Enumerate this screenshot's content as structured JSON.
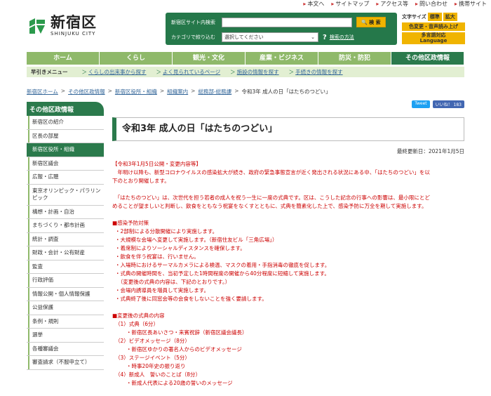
{
  "util_links": [
    "本文へ",
    "サイトマップ",
    "アクセス等",
    "問い合わせ",
    "携帯サイト"
  ],
  "logo": {
    "name": "新宿区",
    "roman": "SHINJUKU CITY"
  },
  "search": {
    "site_label": "新宿区サイト内検索",
    "button": "検 索",
    "category_label": "カテゴリで絞り込む",
    "category_value": "選択してください",
    "help_q": "?",
    "help_link": "検索の方法"
  },
  "tools": {
    "font_size_label": "文字サイズ",
    "standard": "標準",
    "enlarge": "拡大",
    "color_voice": "色変更・音声読み上げ",
    "multilang_1": "多言語対応",
    "multilang_2": "Language"
  },
  "gnav": [
    "ホーム",
    "くらし",
    "観光・文化",
    "産業・ビジネス",
    "防災・防犯",
    "その他区政情報"
  ],
  "subnav": {
    "title": "早引きメニュー",
    "links": [
      "くらしの出来事から探す",
      "よく見られているページ",
      "施設の情報を探す",
      "手続きの情報を探す"
    ]
  },
  "breadcrumb": [
    "新宿区ホーム",
    "その他区政情報",
    "新宿区役所・組織",
    "組織案内",
    "総務部-総務課",
    "令和3年 成人の日「はたちのつどい」"
  ],
  "sidebar": {
    "heading": "その他区政情報",
    "items": [
      "新宿区の紹介",
      "区長の部屋",
      "新宿区役所・組織",
      "新宿区議会",
      "広報・広聴",
      "東京オリンピック・パラリンピック",
      "構想・計画・自治",
      "まちづくり・都市計画",
      "統計・調査",
      "財政・会計・公有財産",
      "監査",
      "行政評価",
      "情報公開・個人情報保護",
      "公益保護",
      "条例・規則",
      "選挙",
      "各種審議会",
      "審査請求（不服申立て）"
    ]
  },
  "share": {
    "tweet": "Tweet",
    "fb": "いいね！ 183"
  },
  "page_title": "令和3年 成人の日「はたちのつどい」",
  "updated": "最終更新日：2021年1月5日",
  "content": {
    "notice_head": "【令和3年1月5日公開・変更内容等】",
    "notice_1": "　年明け以降も、新型コロナウイルスの感染拡大が続き、政府の緊急事態宣言が近く発出される状況にある中、「はたちのつどい」を以",
    "notice_2": "下のとおり開催します。",
    "para_1": "　「はたちのつどい」は、次世代を担う若者の成人を祝う一生に一度の式典です。区は、こうした記念の行事への影響は、最小限にとど",
    "para_2": "めることが望ましいと判断し、飲食をともなう祝宴をなくすとともに、式典を簡素化した上で、感染予防に万全を期して実施します。",
    "prevent_head": "■感染予防対策",
    "prevent": [
      "・2部制による分散開催により実施します。",
      "・大規模な会場へ変更して実施します。（新宿住友ビル「三角広場」）",
      "・着席制によりソーシャルディスタンスを確保します。",
      "・飲食を伴う祝宴は、行いません。",
      "・入場時におけるサーマルカメラによる検温、マスクの着用・手指消毒の徹底を促します。",
      "・式典の開催時間を、当初予定した1時間程度の開催から40分程度に短縮して実施します。",
      "　（変更後の式典の内容は、下記のとおりです。）",
      "・会場内誘導員を増員して実施します。",
      "・式典終了後に同窓会等の会食をしないことを強く要請します。"
    ],
    "program_head": "■変更後の式典の内容",
    "program": [
      {
        "n": "（1）式典（6分）",
        "d": "・新宿区長あいさつ・来賓祝辞（新宿区議会議長）"
      },
      {
        "n": "（2）ビデオメッセージ（8分）",
        "d": "・新宿区ゆかりの著名人からのビデオメッセージ"
      },
      {
        "n": "（3）ステージイベント（5分）",
        "d": "・時事20年史の振り返り"
      },
      {
        "n": "（4）新成人　誓いのことば（8分）",
        "d": "・新成人代表による20歳の誓いのメッセージ"
      }
    ]
  },
  "colors": {
    "brand_green": "#2b7a4c",
    "light_green": "#8fb96a",
    "accent_yellow": "#f0b400",
    "notice_red": "#cc0000"
  }
}
